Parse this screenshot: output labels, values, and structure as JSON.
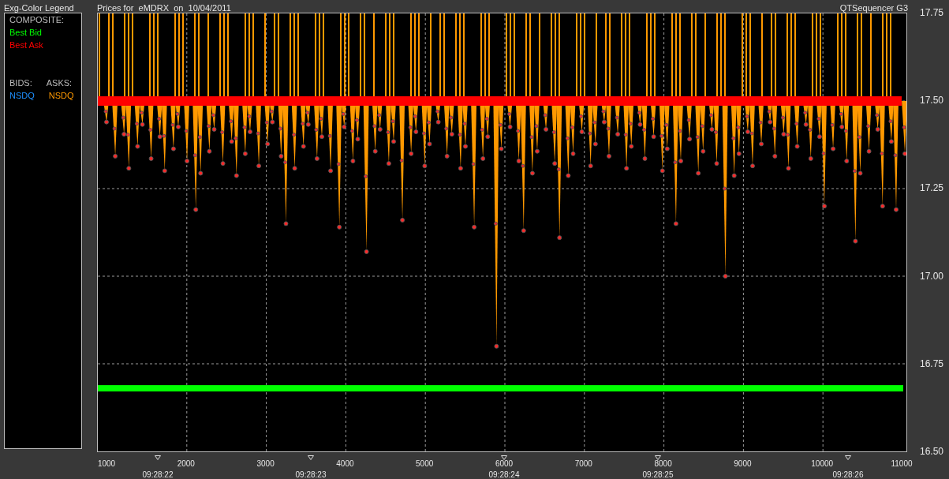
{
  "legend": {
    "title": "Exg-Color Legend",
    "composite_heading": "COMPOSITE:",
    "composite": [
      {
        "label": "Best Bid",
        "color": "#00ff00"
      },
      {
        "label": "Best Ask",
        "color": "#ff0000"
      }
    ],
    "bids_heading": "BIDS:",
    "asks_heading": "ASKS:",
    "bids": [
      {
        "label": "NSDQ",
        "color": "#1e90ff"
      }
    ],
    "asks": [
      {
        "label": "NSDQ",
        "color": "#ff9900"
      }
    ]
  },
  "chart": {
    "title": "Prices for  eMDRX  on  10/04/2011",
    "app_title": "QTSequencer G3",
    "y_labels": [
      "17.75",
      "17.50",
      "17.25",
      "17.00",
      "16.75",
      "16.50"
    ],
    "x_labels": [
      "1000",
      "2000",
      "3000",
      "4000",
      "5000",
      "6000",
      "7000",
      "8000",
      "9000",
      "10000",
      "11000"
    ],
    "time_markers": [
      "09:28:22",
      "09:28:23",
      "09:28:24",
      "09:28:25",
      "09:28:26"
    ]
  }
}
